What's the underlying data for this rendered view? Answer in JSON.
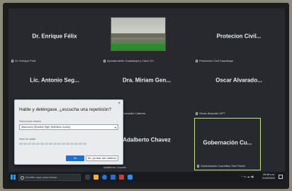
{
  "participants": [
    {
      "display": "Dr. Enrique Félix",
      "user": "Dr. Enrique Felix"
    },
    {
      "display": "",
      "user": "Ayuntamiento Guadalupe y Calvo Ch"
    },
    {
      "display": "Protecion Civil...",
      "user": "Protección Civil Guadalupe"
    },
    {
      "display": "Lic. Antonio Seg...",
      "user": ""
    },
    {
      "display": "Dra. Miriam Gen...",
      "user": "Dra. Miriam Gonzalez Cabrera"
    },
    {
      "display": "Oscar Alvarado...",
      "user": "Oscar Alvarado UPT"
    },
    {
      "display": "",
      "user": ""
    },
    {
      "display": "Adalberto Chavez",
      "user": "Adalberto Chavez"
    },
    {
      "display": "Gobernación Cu...",
      "user": "Gobernación Cuauhtém Yeni Robel"
    }
  ],
  "dialog": {
    "title": "Hable y deténgase, ¿escucha una repetición?",
    "speaker_label": "Seleccionar altavoz",
    "speaker_value": "Altavoces (Realtek High Definition Audio)",
    "volume_label": "Nivel de salida",
    "yes_label": "Sí",
    "no_label": "No, probar otro altavoz",
    "close_glyph": "×"
  },
  "taskbar": {
    "search_placeholder": "Escribe aquí para buscar",
    "time": "09:48 a.m.",
    "date": "21/02/2022",
    "tray_glyphs": "^ ▭ ☁ ◀)"
  },
  "colors": {
    "highlight": "#c9e07a",
    "accent": "#1f6fd1"
  }
}
